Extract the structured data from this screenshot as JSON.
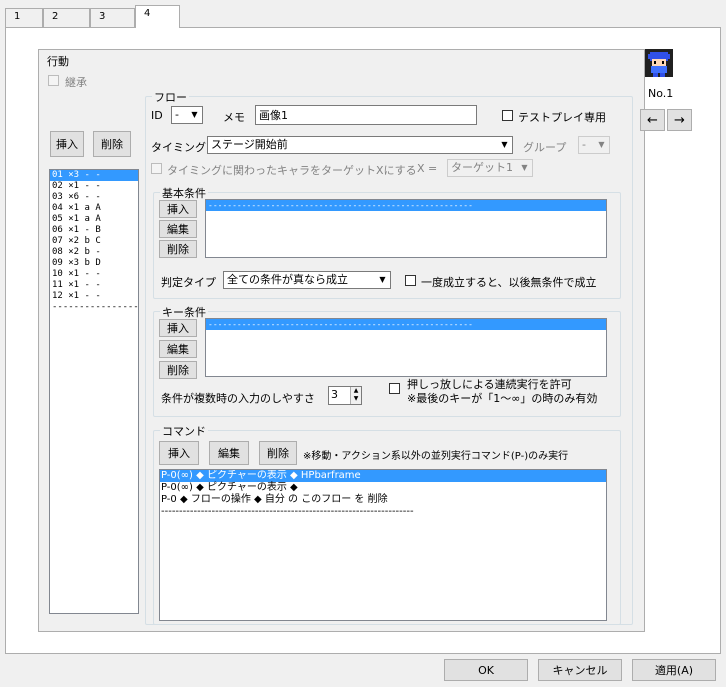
{
  "tabs": [
    "1",
    "2",
    "3",
    "4"
  ],
  "action": {
    "group_label": "行動",
    "inherit_label": "継承",
    "insert_label": "挿入",
    "delete_label": "削除",
    "items": [
      "01 ×3 - -",
      "02 ×1 - -",
      "03 ×6 - -",
      "04 ×1 a A",
      "05 ×1 a A",
      "06 ×1 - B",
      "07 ×2 b C",
      "08 ×2 b -",
      "09 ×3 b D",
      "10 ×1 - -",
      "11 ×1 - -",
      "12 ×1 - -",
      "-------------------"
    ],
    "selected_index": 0
  },
  "flow": {
    "group_label": "フロー",
    "id_label": "ID",
    "id_value": "-",
    "memo_label": "メモ",
    "memo_value": "画像1",
    "testplay_label": "テストプレイ専用",
    "timing_label": "タイミング",
    "timing_value": "ステージ開始前",
    "group_field_label": "グループ",
    "group_value": "-",
    "target_label": "タイミングに関わったキャラをターゲットXにする",
    "x_label": "X =",
    "target_value": "ターゲット1"
  },
  "basic_condition": {
    "group_label": "基本条件",
    "insert_label": "挿入",
    "edit_label": "編集",
    "delete_label": "削除",
    "first_item": "-------------------------------------------------------",
    "judge_label": "判定タイプ",
    "judge_value": "全ての条件が真なら成立",
    "once_label": "一度成立すると、以後無条件で成立"
  },
  "key_condition": {
    "group_label": "キー条件",
    "insert_label": "挿入",
    "edit_label": "編集",
    "delete_label": "削除",
    "first_item": "-------------------------------------------------------",
    "ease_label": "条件が複数時の入力のしやすさ",
    "ease_value": "3",
    "hold_label": "押しっ放しによる連続実行を許可",
    "hold_note": "※最後のキーが「1～∞」の時のみ有効"
  },
  "command": {
    "group_label": "コマンド",
    "insert_label": "挿入",
    "edit_label": "編集",
    "delete_label": "削除",
    "note": "※移動・アクション系以外の並列実行コマンド(P-)のみ実行",
    "lines": [
      "P-0(∞) ◆ ピクチャーの表示 ◆ HPbarframe",
      "P-0(∞) ◆ ピクチャーの表示 ◆",
      "P-0 ◆ フローの操作 ◆ 自分 の このフロー を 削除",
      "----------------------------------------------------------------------"
    ],
    "selected_index": 0
  },
  "character": {
    "number_label": "No.1",
    "prev_label": "←",
    "next_label": "→"
  },
  "footer": {
    "ok_label": "OK",
    "cancel_label": "キャンセル",
    "apply_label": "適用(A)"
  },
  "colors": {
    "selection": "#3399ff",
    "face": "#f0f0f0"
  }
}
